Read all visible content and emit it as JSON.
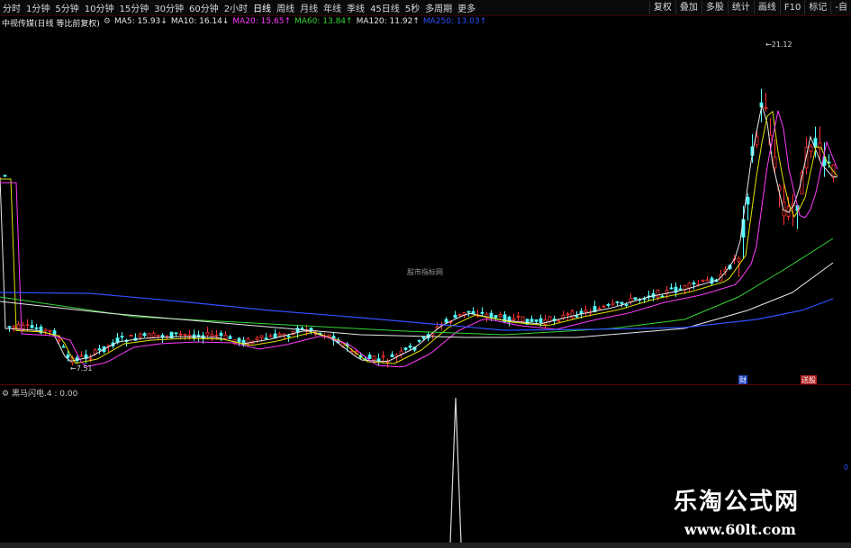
{
  "periods": [
    {
      "label": "分时"
    },
    {
      "label": "1分钟"
    },
    {
      "label": "5分钟"
    },
    {
      "label": "10分钟"
    },
    {
      "label": "15分钟"
    },
    {
      "label": "30分钟"
    },
    {
      "label": "60分钟"
    },
    {
      "label": "2小时"
    },
    {
      "label": "日线"
    },
    {
      "label": "周线"
    },
    {
      "label": "月线"
    },
    {
      "label": "年线"
    },
    {
      "label": "季线"
    },
    {
      "label": "45日线"
    },
    {
      "label": "5秒"
    },
    {
      "label": "多周期"
    },
    {
      "label": "更多"
    }
  ],
  "right_buttons": [
    {
      "label": "复权"
    },
    {
      "label": "叠加"
    },
    {
      "label": "多股"
    },
    {
      "label": "统计"
    },
    {
      "label": "画线"
    },
    {
      "label": "F10"
    },
    {
      "label": "标记"
    },
    {
      "label": "-自"
    }
  ],
  "legend": {
    "stock_name": "中视传媒(日线 等比前复权)",
    "items": [
      {
        "text": "MA5: 15.93↓",
        "color": "#e8e8e8"
      },
      {
        "text": "MA10: 16.14↓",
        "color": "#e8e8e8"
      },
      {
        "text": "MA20: 15.65↑",
        "color": "#ff3cff"
      },
      {
        "text": "MA60: 13.84↑",
        "color": "#36d436"
      },
      {
        "text": "MA120: 11.92↑",
        "color": "#e8e8e8"
      },
      {
        "text": "MA250: 13.03↑",
        "color": "#3050ff"
      }
    ]
  },
  "annotations": {
    "high": "21.12",
    "low": "7.51",
    "watermark_center": "股市指标网",
    "marker_a": "财",
    "marker_b": "送股"
  },
  "indicator": {
    "title": "黑马闪电.4 : 0.00",
    "right_value": "0"
  },
  "watermark": {
    "big": "乐淘公式网",
    "url": "www.60lt.com"
  },
  "colors": {
    "up": "#ff3232",
    "down": "#54ffff",
    "ma5": "#e8e8e8",
    "ma10": "#e0e000",
    "ma20": "#ff3cff",
    "ma60": "#36d436",
    "ma120": "#e8e8e8",
    "ma250": "#3050ff"
  }
}
